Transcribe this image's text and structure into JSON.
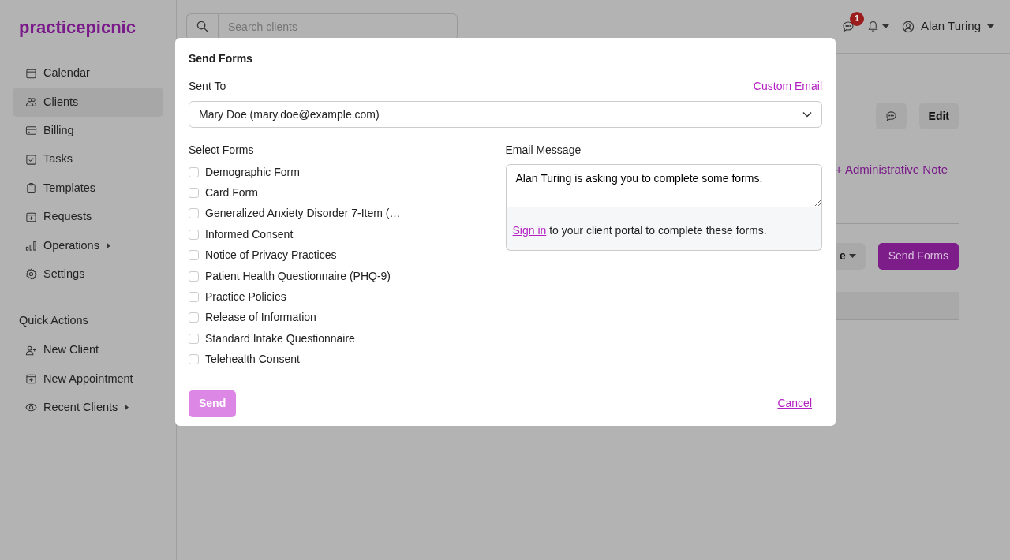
{
  "brand": "practicepicnic",
  "sidebar": {
    "items": [
      {
        "label": "Calendar",
        "selected": false,
        "submenu": false
      },
      {
        "label": "Clients",
        "selected": true,
        "submenu": false
      },
      {
        "label": "Billing",
        "selected": false,
        "submenu": false
      },
      {
        "label": "Tasks",
        "selected": false,
        "submenu": false
      },
      {
        "label": "Templates",
        "selected": false,
        "submenu": false
      },
      {
        "label": "Requests",
        "selected": false,
        "submenu": false
      },
      {
        "label": "Operations",
        "selected": false,
        "submenu": true
      },
      {
        "label": "Settings",
        "selected": false,
        "submenu": false
      }
    ],
    "quick_actions_title": "Quick Actions",
    "quick_actions": [
      {
        "label": "New Client",
        "submenu": false
      },
      {
        "label": "New Appointment",
        "submenu": false
      },
      {
        "label": "Recent Clients",
        "submenu": true
      }
    ]
  },
  "topbar": {
    "search": {
      "placeholder": "Search clients"
    },
    "messages_badge": "1",
    "user": "Alan Turing"
  },
  "client_page": {
    "edit_button": "Edit",
    "administrative_note": "+ Administrative Note",
    "dropdown_partial": "e",
    "send_forms_button": "Send Forms"
  },
  "modal": {
    "title": "Send Forms",
    "sent_to_label": "Sent To",
    "custom_email_link": "Custom Email",
    "recipient": "Mary Doe (mary.doe@example.com)",
    "select_forms_label": "Select Forms",
    "forms": [
      {
        "label": "Demographic Form",
        "checked": false
      },
      {
        "label": "Card Form",
        "checked": false
      },
      {
        "label": "Generalized Anxiety Disorder 7-Item (…",
        "checked": false
      },
      {
        "label": "Informed Consent",
        "checked": false
      },
      {
        "label": "Notice of Privacy Practices",
        "checked": false
      },
      {
        "label": "Patient Health Questionnaire (PHQ-9)",
        "checked": false
      },
      {
        "label": "Practice Policies",
        "checked": false
      },
      {
        "label": "Release of Information",
        "checked": false
      },
      {
        "label": "Standard Intake Questionnaire",
        "checked": false
      },
      {
        "label": "Telehealth Consent",
        "checked": false
      }
    ],
    "email_message_label": "Email Message",
    "email_message": "Alan Turing is asking you to complete some forms.",
    "footer_link": "Sign in",
    "footer_text": " to your client portal to complete these forms.",
    "send_button": {
      "label": "Send",
      "disabled": true
    },
    "cancel_link": "Cancel"
  }
}
